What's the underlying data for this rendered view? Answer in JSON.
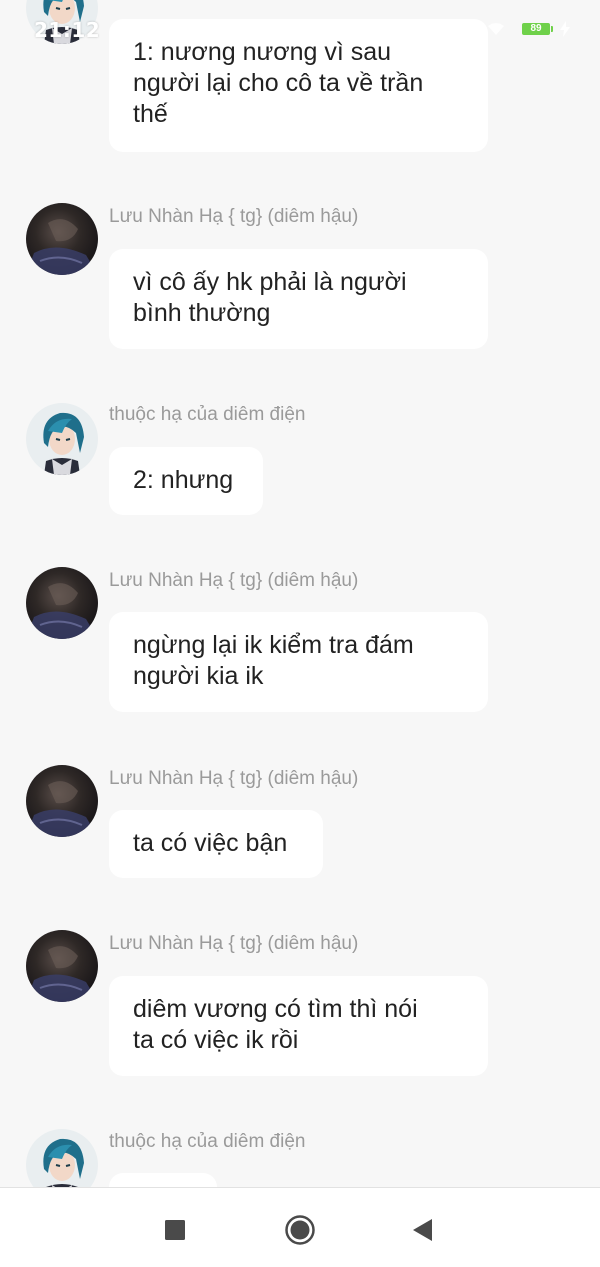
{
  "status_bar": {
    "time": "21:12",
    "battery": "89"
  },
  "messages": [
    {
      "avatar": "teal-hair-character-avatar",
      "sender": "",
      "text": "1: nương nương vì sau\nngười lại cho cô ta về trần\nthế"
    },
    {
      "avatar": "dark-photo-avatar",
      "sender": "Lưu Nhàn Hạ { tg} (diêm hậu)",
      "text": "vì cô ấy hk phải là người\nbình thường"
    },
    {
      "avatar": "teal-hair-character-avatar",
      "sender": "thuộc hạ của diêm điện",
      "text": "2: nhưng"
    },
    {
      "avatar": "dark-photo-avatar",
      "sender": "Lưu Nhàn Hạ { tg} (diêm hậu)",
      "text": "ngừng lại ik kiểm tra đám\nngười kia ik"
    },
    {
      "avatar": "dark-photo-avatar",
      "sender": "Lưu Nhàn Hạ { tg} (diêm hậu)",
      "text": "ta có việc bận"
    },
    {
      "avatar": "dark-photo-avatar",
      "sender": "Lưu Nhàn Hạ { tg} (diêm hậu)",
      "text": "diêm vương có tìm thì nói\nta có việc ik rồi"
    },
    {
      "avatar": "teal-hair-character-avatar",
      "sender": "thuộc hạ của diêm điện",
      "text": ""
    }
  ],
  "nav_bar": {
    "icons": [
      "recent-apps-icon",
      "home-icon",
      "back-icon"
    ]
  }
}
